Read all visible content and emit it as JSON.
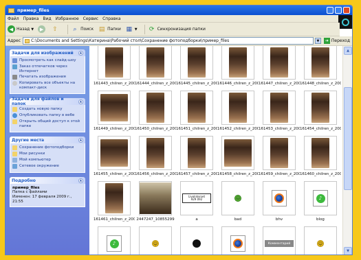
{
  "window": {
    "title": "пример_files"
  },
  "menu": [
    "Файл",
    "Правка",
    "Вид",
    "Избранное",
    "Сервис",
    "Справка"
  ],
  "toolbar": {
    "back": "Назад",
    "search": "Поиск",
    "folders": "Папки",
    "sync": "Синхронизация папки"
  },
  "address": {
    "label": "Адрес",
    "path": "C:\\Documents and Settings\\Катерина\\Рабочий стол\\Сохранение фотоподборки\\пример_files",
    "go": "Переход"
  },
  "sidebar": {
    "image_tasks": {
      "title": "Задачи для изображений",
      "items": [
        "Просмотреть как слайд-шоу",
        "Заказ отпечатков через Интернет",
        "Печатать изображения",
        "Копировать все объекты на компакт-диск"
      ]
    },
    "file_tasks": {
      "title": "Задачи для файлов и папок",
      "items": [
        "Создать новую папку",
        "Опубликовать папку в вебе",
        "Открыть общий доступ к этой папке"
      ]
    },
    "other_places": {
      "title": "Другие места",
      "items": [
        "Сохранение фотоподборки",
        "Мои рисунки",
        "Мой компьютер",
        "Сетевое окружение"
      ]
    },
    "details": {
      "title": "Подробно",
      "name": "пример_files",
      "type": "Папка с файлами",
      "modified": "Изменен: 17 февраля 2009 г., 21:55"
    }
  },
  "files": [
    {
      "name": "161443_chilren_z_200..."
    },
    {
      "name": "161444_chilren_z_200..."
    },
    {
      "name": "161445_chilren_z_200..."
    },
    {
      "name": "161446_chilren_z_200..."
    },
    {
      "name": "161447_chilren_z_200..."
    },
    {
      "name": "161448_chilren_z_200..."
    },
    {
      "name": "161449_chilren_z_200..."
    },
    {
      "name": "161450_chilren_z_200..."
    },
    {
      "name": "161451_chilren_z_200..."
    },
    {
      "name": "161452_chilren_z_200..."
    },
    {
      "name": "161453_chilren_z_200..."
    },
    {
      "name": "161454_chilren_z_200..."
    },
    {
      "name": "161455_chilren_z_200..."
    },
    {
      "name": "161456_chilren_z_200..."
    },
    {
      "name": "161457_chilren_z_200..."
    },
    {
      "name": "161458_chilren_z_200..."
    },
    {
      "name": "161459_chilren_z_200..."
    },
    {
      "name": "161460_chilren_z_200..."
    },
    {
      "name": "161461_chilren_z_200..."
    },
    {
      "name": "2447247_10855299"
    },
    {
      "name": "a"
    },
    {
      "name": "bad"
    },
    {
      "name": "bhv"
    },
    {
      "name": "blog"
    },
    {
      "name": ""
    },
    {
      "name": ""
    },
    {
      "name": ""
    },
    {
      "name": ""
    },
    {
      "name": ""
    },
    {
      "name": ""
    }
  ],
  "banner_text": {
    "line1": "LiveInternet",
    "line2": "929 092"
  },
  "comment_label": "Комментарий"
}
